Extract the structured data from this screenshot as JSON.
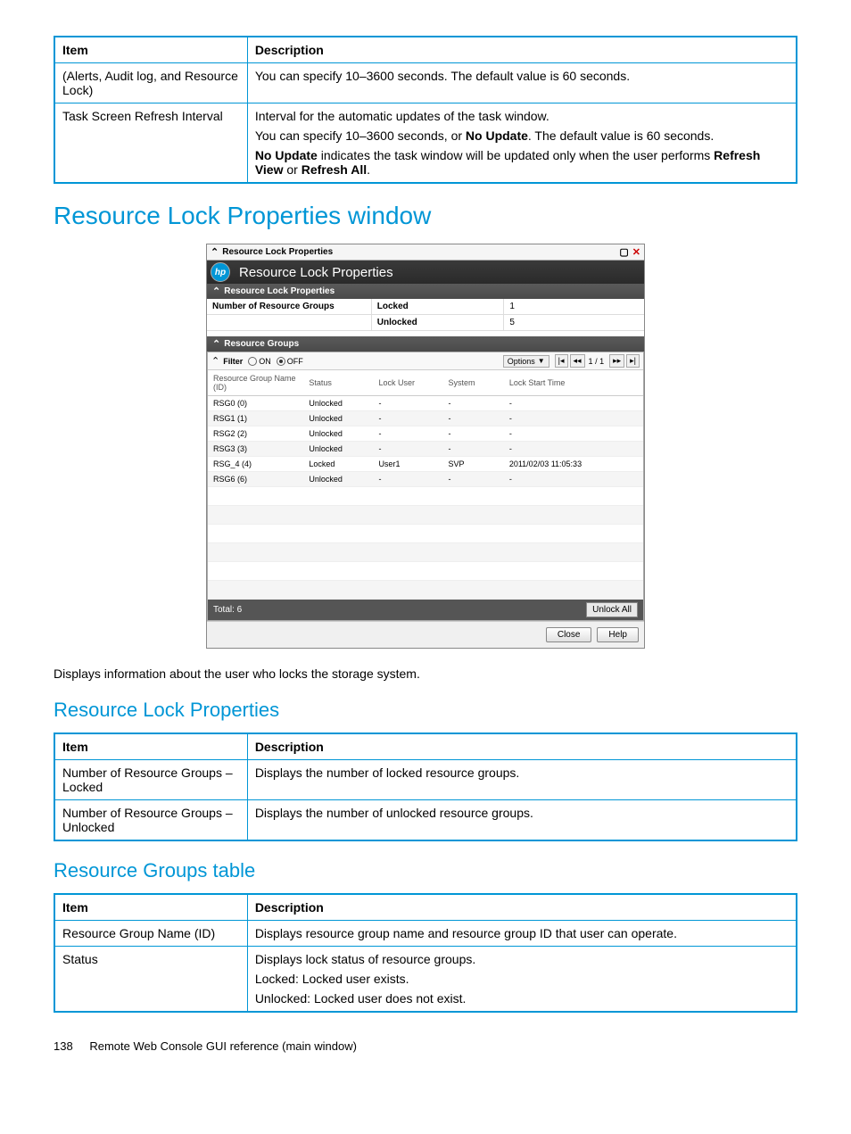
{
  "table1": {
    "headers": [
      "Item",
      "Description"
    ],
    "rows": [
      {
        "item": "(Alerts, Audit log, and Resource Lock)",
        "desc": "You can specify 10–3600 seconds. The default value is 60 seconds."
      },
      {
        "item": "Task Screen Refresh Interval",
        "desc_p1": "Interval for the automatic updates of the task window.",
        "desc_p2_a": "You can specify 10–3600 seconds, or ",
        "desc_p2_bold": "No Update",
        "desc_p2_b": ". The default value is 60 seconds.",
        "desc_p3_bold1": "No Update",
        "desc_p3_a": " indicates the task window will be updated only when the user performs ",
        "desc_p3_bold2": "Refresh View",
        "desc_p3_b": " or ",
        "desc_p3_bold3": "Refresh All",
        "desc_p3_c": "."
      }
    ]
  },
  "h1": "Resource Lock Properties window",
  "screenshot": {
    "titlebar": "Resource Lock Properties",
    "header": "Resource Lock Properties",
    "section_props": "Resource Lock Properties",
    "props": {
      "label": "Number of Resource Groups",
      "locked_label": "Locked",
      "locked_value": "1",
      "unlocked_label": "Unlocked",
      "unlocked_value": "5"
    },
    "section_groups": "Resource Groups",
    "toolbar": {
      "filter": "Filter",
      "on": "ON",
      "off": "OFF",
      "options": "Options",
      "page_current": "1",
      "page_total": "1"
    },
    "cols": {
      "c1": "Resource Group Name (ID)",
      "c2": "Status",
      "c3": "Lock User",
      "c4": "System",
      "c5": "Lock Start Time"
    },
    "rows": [
      {
        "name": "RSG0 (0)",
        "status": "Unlocked",
        "user": "-",
        "system": "-",
        "time": "-"
      },
      {
        "name": "RSG1 (1)",
        "status": "Unlocked",
        "user": "-",
        "system": "-",
        "time": "-"
      },
      {
        "name": "RSG2 (2)",
        "status": "Unlocked",
        "user": "-",
        "system": "-",
        "time": "-"
      },
      {
        "name": "RSG3 (3)",
        "status": "Unlocked",
        "user": "-",
        "system": "-",
        "time": "-"
      },
      {
        "name": "RSG_4 (4)",
        "status": "Locked",
        "user": "User1",
        "system": "SVP",
        "time": "2011/02/03 11:05:33"
      },
      {
        "name": "RSG6 (6)",
        "status": "Unlocked",
        "user": "-",
        "system": "-",
        "time": "-"
      }
    ],
    "total": "Total: 6",
    "unlock_all": "Unlock All",
    "close": "Close",
    "help": "Help"
  },
  "desc_text": "Displays information about the user who locks the storage system.",
  "section2": {
    "title": "Resource Lock Properties",
    "headers": [
      "Item",
      "Description"
    ],
    "rows": [
      {
        "item": "Number of Resource Groups – Locked",
        "desc": "Displays the number of locked resource groups."
      },
      {
        "item": "Number of Resource Groups – Unlocked",
        "desc": "Displays the number of unlocked resource groups."
      }
    ]
  },
  "section3": {
    "title": "Resource Groups table",
    "headers": [
      "Item",
      "Description"
    ],
    "rows": [
      {
        "item": "Resource Group Name (ID)",
        "desc": "Displays resource group name and resource group ID that user can operate."
      },
      {
        "item": "Status",
        "desc_p1": "Displays lock status of resource groups.",
        "desc_p2": "Locked: Locked user exists.",
        "desc_p3": "Unlocked: Locked user does not exist."
      }
    ]
  },
  "footer": {
    "page": "138",
    "title": "Remote Web Console GUI reference (main window)"
  }
}
